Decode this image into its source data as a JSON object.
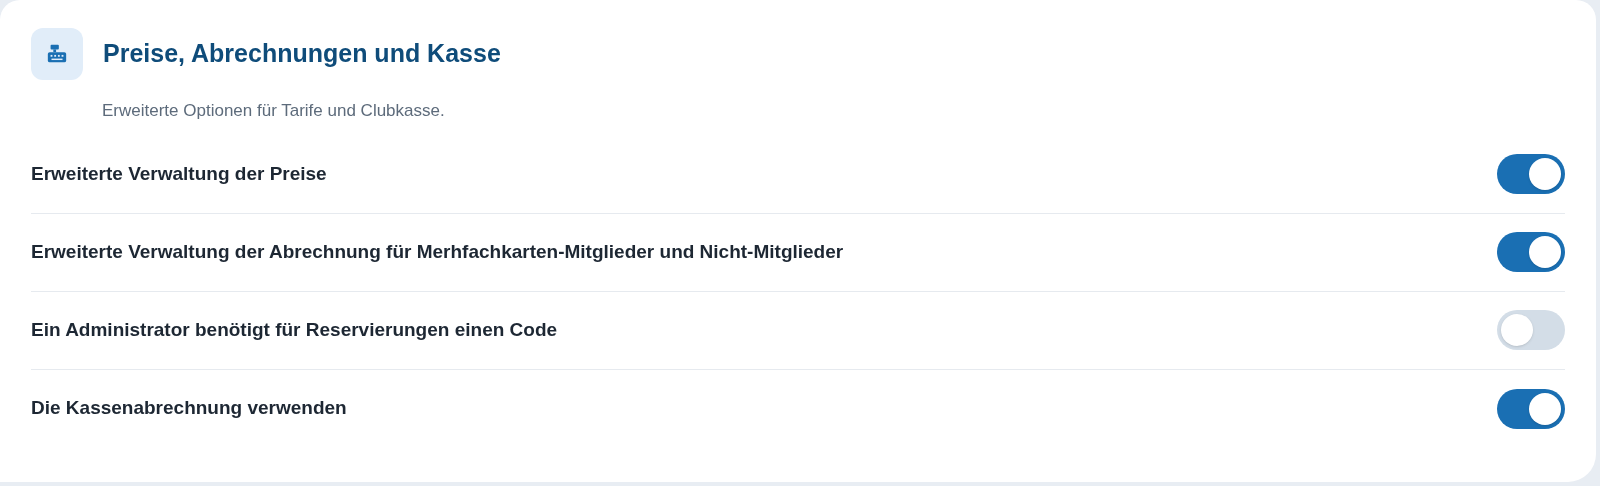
{
  "section": {
    "title": "Preise, Abrechnungen und Kasse",
    "description": "Erweiterte Optionen für Tarife und Clubkasse."
  },
  "settings": [
    {
      "label": "Erweiterte Verwaltung der Preise",
      "on": true
    },
    {
      "label": "Erweiterte Verwaltung der Abrechnung für Merhfachkarten-Mitglieder und Nicht-Mitglieder",
      "on": true
    },
    {
      "label": "Ein Administrator benötigt für Reservierungen einen Code",
      "on": false
    },
    {
      "label": "Die Kassenabrechnung verwenden",
      "on": true
    }
  ]
}
